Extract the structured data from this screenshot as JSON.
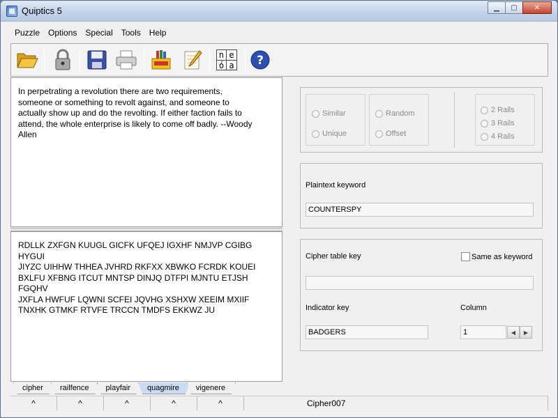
{
  "window": {
    "title": "Quiptics 5"
  },
  "menu": [
    "Puzzle",
    "Options",
    "Special",
    "Tools",
    "Help"
  ],
  "toolbar_icons": [
    "folder-open-icon",
    "lock-icon",
    "save-icon",
    "printer-icon",
    "crayons-icon",
    "notepad-pencil-icon",
    "nea-letters-icon",
    "help-icon"
  ],
  "nea_icon": {
    "letters": [
      "n",
      "e",
      "ó",
      "a"
    ]
  },
  "plaintext": "In perpetrating a revolution there are two requirements,\nsomeone or something to revolt against, and someone to\nactually show up and do the revolting. If either faction fails to\nattend, the whole enterprise is likely to come off badly. --Woody\nAllen",
  "ciphertext": "RDLLK ZXFGN KUUGL GICFK UFQEJ IGXHF NMJVP CGIBG HYGUI\nJIYZC UIHHW THHEA JVHRD RKFXX XBWKO FCRDK KOUEI\nBXLFU XFBNG ITCUT MNTSP DINJQ DTFPI MJNTU ETJSH FGQHV\nJXFLA HWFUF LQWNI SCFEI JQVHG XSHXW XEEIM MXIIF\nTNXHK GTMKF RTVFE TRCCN TMDFS EKKWZ JU",
  "tabs": [
    "cipher",
    "railfence",
    "playfair",
    "quagmire",
    "vigenere"
  ],
  "active_tab": "quagmire",
  "status": {
    "carets": [
      "^",
      "^",
      "^",
      "^",
      "^"
    ],
    "name": "Cipher007"
  },
  "options": {
    "radio_left": [
      "Similar",
      "Unique"
    ],
    "radio_mid": [
      "Random",
      "Offset"
    ],
    "rails": [
      "2 Rails",
      "3 Rails",
      "4 Rails"
    ]
  },
  "plaintext_keyword": {
    "label": "Plaintext keyword",
    "value": "COUNTERSPY"
  },
  "cipher_table": {
    "label": "Cipher table key",
    "same_as_keyword_label": "Same as keyword",
    "value": "",
    "indicator_label": "Indicator key",
    "indicator_value": "BADGERS",
    "column_label": "Column",
    "column_value": "1"
  },
  "colors": {
    "accent": "#c9dcf2",
    "help": "#2b4fb5"
  }
}
